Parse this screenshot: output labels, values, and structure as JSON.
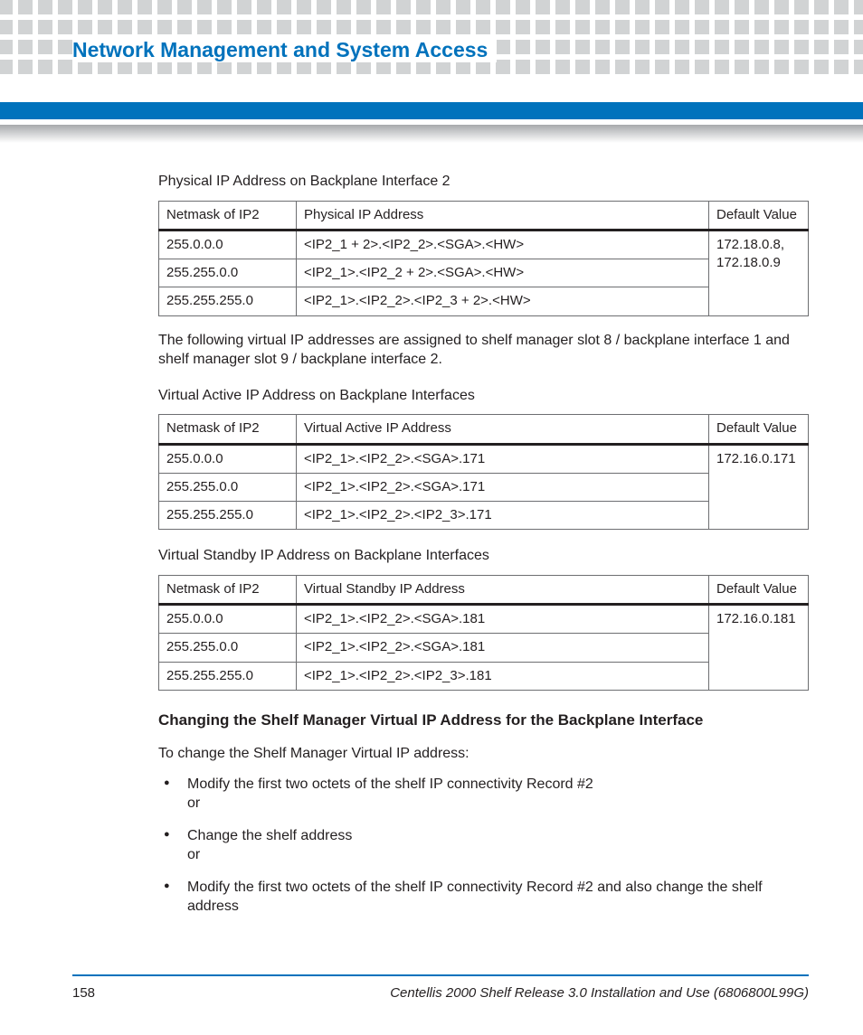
{
  "header": {
    "title": "Network Management and System Access"
  },
  "section1": {
    "caption": "Physical IP Address on Backplane Interface 2",
    "headers": [
      "Netmask of IP2",
      "Physical IP Address",
      "Default Value"
    ],
    "rows": [
      {
        "netmask": "255.0.0.0",
        "addr": "<IP2_1 + 2>.<IP2_2>.<SGA>.<HW>"
      },
      {
        "netmask": "255.255.0.0",
        "addr": "<IP2_1>.<IP2_2 + 2>.<SGA>.<HW>"
      },
      {
        "netmask": "255.255.255.0",
        "addr": "<IP2_1>.<IP2_2>.<IP2_3 + 2>.<HW>"
      }
    ],
    "default_value": "172.18.0.8, 172.18.0.9"
  },
  "intertext": "The following virtual IP addresses are assigned to shelf manager slot 8 / backplane interface 1 and shelf manager slot 9 / backplane interface 2.",
  "section2": {
    "caption": "Virtual Active IP Address on Backplane Interfaces",
    "headers": [
      "Netmask of IP2",
      "Virtual Active IP Address",
      "Default Value"
    ],
    "rows": [
      {
        "netmask": "255.0.0.0",
        "addr": "<IP2_1>.<IP2_2>.<SGA>.171"
      },
      {
        "netmask": "255.255.0.0",
        "addr": "<IP2_1>.<IP2_2>.<SGA>.171"
      },
      {
        "netmask": "255.255.255.0",
        "addr": "<IP2_1>.<IP2_2>.<IP2_3>.171"
      }
    ],
    "default_value": "172.16.0.171"
  },
  "section3": {
    "caption": "Virtual Standby IP Address on Backplane Interfaces",
    "headers": [
      "Netmask of IP2",
      "Virtual Standby IP Address",
      "Default Value"
    ],
    "rows": [
      {
        "netmask": "255.0.0.0",
        "addr": "<IP2_1>.<IP2_2>.<SGA>.181"
      },
      {
        "netmask": "255.255.0.0",
        "addr": "<IP2_1>.<IP2_2>.<SGA>.181"
      },
      {
        "netmask": "255.255.255.0",
        "addr": "<IP2_1>.<IP2_2>.<IP2_3>.181"
      }
    ],
    "default_value": "172.16.0.181"
  },
  "subsection": {
    "heading": "Changing the Shelf Manager Virtual IP Address for the Backplane Interface",
    "intro": "To change the Shelf Manager Virtual IP address:",
    "bullets": [
      "Modify the first two octets of the shelf IP connectivity Record #2\nor",
      "Change the shelf address\nor",
      "Modify the first two octets of the shelf IP connectivity Record #2 and also change the shelf address"
    ]
  },
  "footer": {
    "page_number": "158",
    "doc_title": "Centellis 2000 Shelf Release 3.0 Installation and Use (6806800L99G)"
  }
}
